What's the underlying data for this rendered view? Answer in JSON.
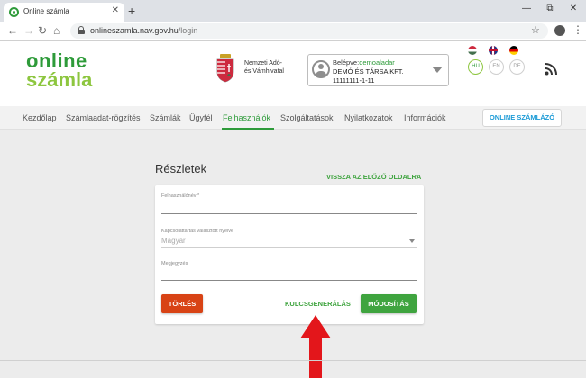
{
  "browser": {
    "tab_title": "Online számla",
    "url_host": "onlineszamla.nav.gov.hu",
    "url_path": "/login",
    "new_tab": "+",
    "close": "✕"
  },
  "header": {
    "logo_line1": "online",
    "logo_line2": "számla",
    "agency_line1": "Nemzeti Adó-",
    "agency_line2": "és Vámhivatal",
    "user_prefix": "Belépve:",
    "user_name": "demoaladar",
    "company": "DEMÓ ÉS TÁRSA KFT.",
    "tax_id": "11111111-1-11",
    "languages": [
      "HU",
      "EN",
      "DE"
    ]
  },
  "nav": {
    "items": [
      "Kezdőlap",
      "Számlaadat-rögzítés",
      "Számlák",
      "Ügyfél",
      "Felhasználók",
      "Szolgáltatások",
      "Nyilatkozatok",
      "Információk"
    ],
    "active": "Felhasználók",
    "online_szamlazo": "ONLINE SZÁMLÁZÓ"
  },
  "page": {
    "title": "Részletek",
    "back_link": "VISSZA AZ ELŐZŐ OLDALRA",
    "fields": {
      "username_label": "Felhasználónév *",
      "username_value": "",
      "language_label": "Kapcsolattartás választott nyelve",
      "language_value": "Magyar",
      "note_label": "Megjegyzés",
      "note_value": ""
    },
    "buttons": {
      "delete": "TÖRLÉS",
      "keygen": "KULCSGENERÁLÁS",
      "modify": "MÓDOSÍTÁS"
    }
  },
  "colors": {
    "brand_green": "#2e9b3a",
    "light_green": "#8dc63f",
    "danger": "#d84315",
    "accent_blue": "#1a9ad6",
    "arrow_red": "#e3161b"
  }
}
